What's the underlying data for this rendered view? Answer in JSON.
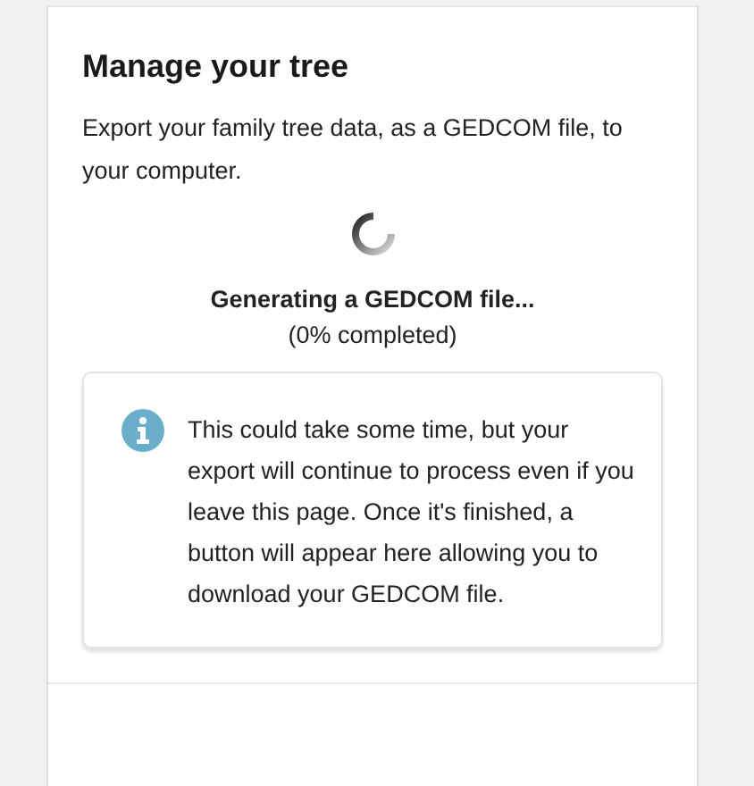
{
  "section": {
    "title": "Manage your tree",
    "description": "Export your family tree data, as a GEDCOM file, to your computer."
  },
  "progress": {
    "status": "Generating a GEDCOM file...",
    "percent_text": "(0% completed)"
  },
  "notice": {
    "text": "This could take some time, but your export will continue to process even if you leave this page. Once it's finished, a button will appear here allowing you to download your GEDCOM file."
  }
}
